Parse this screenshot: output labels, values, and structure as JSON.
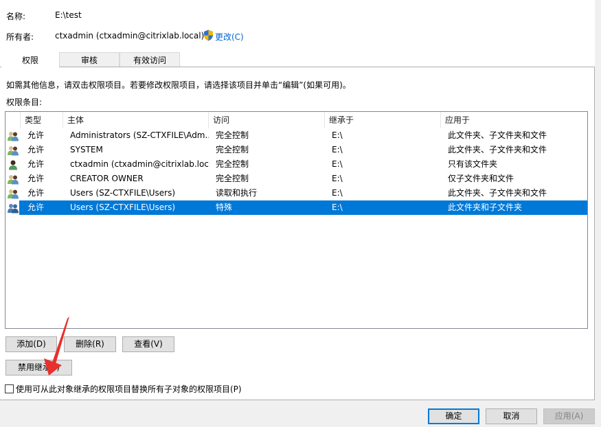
{
  "header": {
    "name_label": "名称:",
    "name_value": "E:\\test",
    "owner_label": "所有者:",
    "owner_value": "ctxadmin (ctxadmin@citrixlab.local)",
    "change_owner_link": "更改(C)",
    "shield_icon": "uac-shield-icon"
  },
  "tabs": [
    {
      "label": "权限",
      "active": true
    },
    {
      "label": "审核",
      "active": false
    },
    {
      "label": "有效访问",
      "active": false
    }
  ],
  "info_text": "如需其他信息，请双击权限项目。若要修改权限项目，请选择该项目并单击“编辑”(如果可用)。",
  "entries_label": "权限条目:",
  "table": {
    "columns": [
      "类型",
      "主体",
      "访问",
      "继承于",
      "应用于"
    ],
    "rows": [
      {
        "icon": "group-icon",
        "type": "允许",
        "principal": "Administrators (SZ-CTXFILE\\Adm...",
        "access": "完全控制",
        "inherited_from": "E:\\",
        "applies_to": "此文件夹、子文件夹和文件",
        "selected": false
      },
      {
        "icon": "group-icon",
        "type": "允许",
        "principal": "SYSTEM",
        "access": "完全控制",
        "inherited_from": "E:\\",
        "applies_to": "此文件夹、子文件夹和文件",
        "selected": false
      },
      {
        "icon": "user-icon",
        "type": "允许",
        "principal": "ctxadmin (ctxadmin@citrixlab.loc...",
        "access": "完全控制",
        "inherited_from": "E:\\",
        "applies_to": "只有该文件夹",
        "selected": false
      },
      {
        "icon": "group-icon",
        "type": "允许",
        "principal": "CREATOR OWNER",
        "access": "完全控制",
        "inherited_from": "E:\\",
        "applies_to": "仅子文件夹和文件",
        "selected": false
      },
      {
        "icon": "group-icon",
        "type": "允许",
        "principal": "Users (SZ-CTXFILE\\Users)",
        "access": "读取和执行",
        "inherited_from": "E:\\",
        "applies_to": "此文件夹、子文件夹和文件",
        "selected": false
      },
      {
        "icon": "group-icon",
        "type": "允许",
        "principal": "Users (SZ-CTXFILE\\Users)",
        "access": "特殊",
        "inherited_from": "E:\\",
        "applies_to": "此文件夹和子文件夹",
        "selected": true
      }
    ]
  },
  "buttons": {
    "add": "添加(D)",
    "remove": "删除(R)",
    "view": "查看(V)",
    "disable_inheritance": "禁用继承(I)"
  },
  "replace_checkbox": {
    "label": "使用可从此对象继承的权限项目替换所有子对象的权限项目(P)",
    "checked": false
  },
  "footer": {
    "ok": "确定",
    "cancel": "取消",
    "apply": "应用(A)"
  },
  "annotation": {
    "type": "red-arrow",
    "points_to": "disable_inheritance",
    "color": "#e8302d"
  },
  "colors": {
    "selection": "#0078d7",
    "link": "#0066cc",
    "annotation": "#e8302d"
  }
}
